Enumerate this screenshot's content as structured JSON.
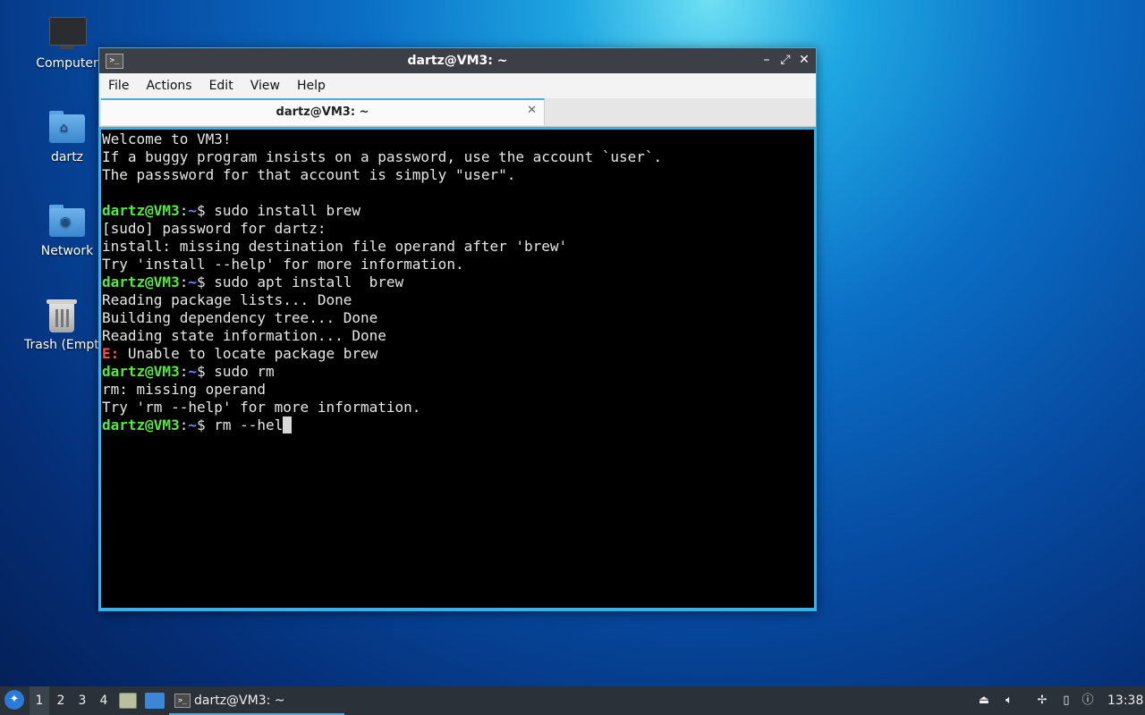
{
  "desktop": {
    "icons": [
      {
        "label": "Computer"
      },
      {
        "label": "dartz"
      },
      {
        "label": "Network"
      },
      {
        "label": "Trash (Empty)"
      }
    ]
  },
  "window": {
    "title": "dartz@VM3: ~",
    "minimize_glyph": "–",
    "maximize_glyph": "⤢",
    "close_glyph": "✕",
    "menu": [
      "File",
      "Actions",
      "Edit",
      "View",
      "Help"
    ],
    "tab": {
      "title": "dartz@VM3: ~",
      "close_glyph": "✕"
    }
  },
  "terminal": {
    "prompt": {
      "user": "dartz@VM3",
      "colon": ":",
      "path": "~",
      "sign": "$"
    },
    "lines": [
      "Welcome to VM3!",
      "If a buggy program insists on a password, use the account `user`.",
      "The passsword for that account is simply \"user\".",
      "",
      " sudo install brew",
      "[sudo] password for dartz:",
      "install: missing destination file operand after 'brew'",
      "Try 'install --help' for more information.",
      " sudo apt install  brew",
      "Reading package lists... Done",
      "Building dependency tree... Done",
      "Reading state information... Done",
      "E:",
      " Unable to locate package brew",
      " sudo rm",
      "rm: missing operand",
      "Try 'rm --help' for more information.",
      " rm --hel"
    ]
  },
  "taskbar": {
    "workspaces": [
      "1",
      "2",
      "3",
      "4"
    ],
    "task": {
      "label": "dartz@VM3: ~"
    },
    "clock": "13:38",
    "colors": {
      "background": "#2b3138",
      "accent": "#3daee9"
    }
  }
}
